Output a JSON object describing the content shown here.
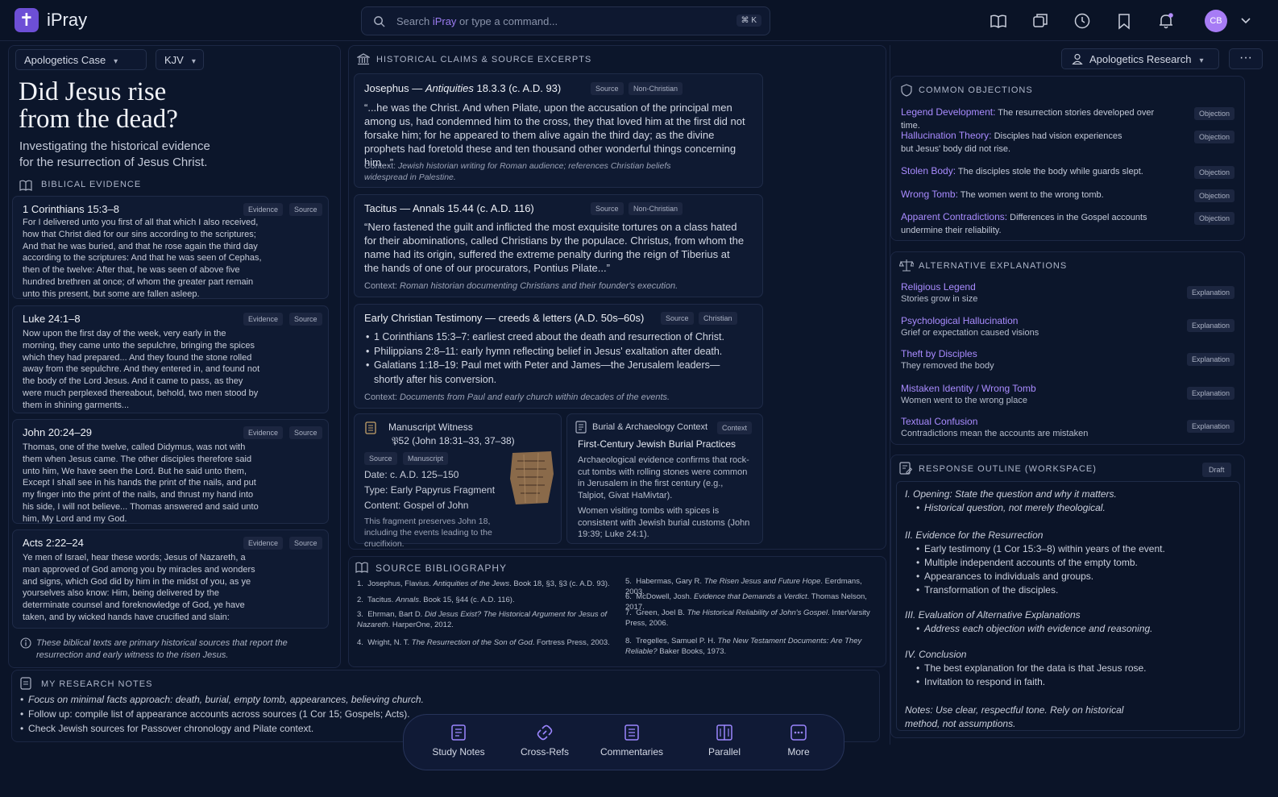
{
  "app": {
    "name": "iPray",
    "logo_glyph": "✝"
  },
  "search": {
    "prefix": "Search ",
    "brand": "iPray",
    "suffix": " or type a command...",
    "shortcut": "⌘ K"
  },
  "topbar": {
    "icons": [
      "book-icon",
      "copy-icon",
      "history-icon",
      "bookmark-icon",
      "bell-icon"
    ],
    "avatar": "CB"
  },
  "left": {
    "case_select": "Apologetics Case",
    "version_select": "KJV",
    "title_line1": "Did Jesus rise",
    "title_line2": "from the dead?",
    "subtitle_line1": "Investigating the historical evidence",
    "subtitle_line2": "for the resurrection of Jesus Christ.",
    "section": "BIBLICAL EVIDENCE",
    "passages": [
      {
        "ref": "1 Corinthians 15:3–8",
        "tag1": "Evidence",
        "tag2": "Source",
        "text": "For I delivered unto you first of all that which I also received, how that Christ died for our sins according to the scriptures; And that he was buried, and that he rose again the third day according to the scriptures: And that he was seen of Cephas, then of the twelve: After that, he was seen of above five hundred brethren at once; of whom the greater part remain unto this present, but some are fallen asleep."
      },
      {
        "ref": "Luke 24:1–8",
        "tag1": "Evidence",
        "tag2": "Source",
        "text": "Now upon the first day of the week, very early in the morning, they came unto the sepulchre, bringing the spices which they had prepared... And they found the stone rolled away from the sepulchre. And they entered in, and found not the body of the Lord Jesus. And it came to pass, as they were much perplexed thereabout, behold, two men stood by them in shining garments..."
      },
      {
        "ref": "John 20:24–29",
        "tag1": "Evidence",
        "tag2": "Source",
        "text": "Thomas, one of the twelve, called Didymus, was not with them when Jesus came. The other disciples therefore said unto him, We have seen the Lord. But he said unto them, Except I shall see in his hands the print of the nails, and put my finger into the print of the nails, and thrust my hand into his side, I will not believe... Thomas answered and said unto him, My Lord and my God."
      },
      {
        "ref": "Acts 2:22–24",
        "tag1": "Evidence",
        "tag2": "Source",
        "text": "Ye men of Israel, hear these words; Jesus of Nazareth, a man approved of God among you by miracles and wonders and signs, which God did by him in the midst of you, as ye yourselves also know: Him, being delivered by the determinate counsel and foreknowledge of God, ye have taken, and by wicked hands have crucified and slain:"
      }
    ],
    "footnote": "These biblical texts are primary historical sources that report the resurrection and early witness to the risen Jesus."
  },
  "notes": {
    "title": "MY RESEARCH NOTES",
    "items": [
      "Focus on minimal facts approach: death, burial, empty tomb, appearances, believing church.",
      "Follow up: compile list of appearance accounts across sources (1 Cor 15; Gospels; Acts).",
      "Check Jewish sources for Passover chronology and Pilate context."
    ]
  },
  "middle": {
    "section": "HISTORICAL CLAIMS & SOURCE EXCERPTS",
    "josephus": {
      "author": "Josephus — ",
      "work": "Antiquities",
      "ref": " 18.3.3 (c. A.D. 93)",
      "tag1": "Source",
      "tag2": "Non-Christian",
      "quote": "“...he was the Christ. And when Pilate, upon the accusation of the principal men among us, had condemned him to the cross, they that loved him at the first did not forsake him; for he appeared to them alive again the third day; as the divine prophets had foretold these and ten thousand other wonderful things concerning him...”",
      "ctx_label": "Context: ",
      "ctx": "Jewish historian writing for Roman audience; references Christian beliefs widespread in Palestine."
    },
    "tacitus": {
      "title": "Tacitus — Annals 15.44 (c. A.D. 116)",
      "tag1": "Source",
      "tag2": "Non-Christian",
      "quote": "“Nero fastened the guilt and inflicted the most exquisite tortures on a class hated for their abominations, called Christians by the populace. Christus, from whom the name had its origin, suffered the extreme penalty during the reign of Tiberius at the hands of one of our procurators, Pontius Pilate...”",
      "ctx_label": "Context: ",
      "ctx": "Roman historian documenting Christians and their founder's execution."
    },
    "early": {
      "title": "Early Christian Testimony — creeds & letters (A.D. 50s–60s)",
      "tag1": "Source",
      "tag2": "Christian",
      "items": [
        "1 Corinthians 15:3–7: earliest creed about the death and resurrection of Christ.",
        "Philippians 2:8–11: early hymn reflecting belief in Jesus' exaltation after death.",
        "Galatians 1:18–19: Paul met with Peter and James—the Jerusalem leaders—shortly after his conversion."
      ],
      "ctx_label": "Context: ",
      "ctx": "Documents from Paul and early church within decades of the events."
    },
    "manuscript": {
      "title": "Manuscript Witness",
      "subtitle": "𝔓52 (John 18:31–33, 37–38)",
      "tag1": "Source",
      "tag2": "Manuscript",
      "date_label": "Date: ",
      "date": "c. A.D. 125–150",
      "type_label": "Type: ",
      "type": "Early Papyrus Fragment",
      "content_label": "Content: ",
      "content": "Gospel of John",
      "desc": "This fragment preserves John 18, including the events leading to the crucifixion."
    },
    "burial": {
      "header": "Burial & Archaeology Context",
      "tag": "Context",
      "title": "First-Century Jewish Burial Practices",
      "p1": "Archaeological evidence confirms that rock-cut tombs with rolling stones were common in Jerusalem in the first century (e.g., Talpiot, Givat HaMivtar).",
      "p2": "Women visiting tombs with spices is consistent with Jewish burial customs (John 19:39; Luke 24:1)."
    },
    "bibliography": {
      "title": "SOURCE BIBLIOGRAPHY",
      "left": [
        {
          "n": "1.",
          "a": "Josephus, Flavius. ",
          "t": "Antiquities of the Jews",
          "r": ". Book 18, §3, §3 (c. A.D. 93)."
        },
        {
          "n": "2.",
          "a": "Tacitus. ",
          "t": "Annals",
          "r": ". Book 15, §44 (c. A.D. 116)."
        },
        {
          "n": "3.",
          "a": "Ehrman, Bart D. ",
          "t": "Did Jesus Exist? The Historical Argument for Jesus of Nazareth",
          "r": ". HarperOne, 2012."
        },
        {
          "n": "4.",
          "a": "Wright, N. T. ",
          "t": "The Resurrection of the Son of God",
          "r": ". Fortress Press, 2003."
        }
      ],
      "right": [
        {
          "n": "5.",
          "a": "Habermas, Gary R. ",
          "t": "The Risen Jesus and Future Hope",
          "r": ". Eerdmans, 2003."
        },
        {
          "n": "6.",
          "a": "McDowell, Josh. ",
          "t": "Evidence that Demands a Verdict",
          "r": ". Thomas Nelson, 2017."
        },
        {
          "n": "7.",
          "a": "Green, Joel B. ",
          "t": "The Historical Reliability of John's Gospel",
          "r": ". InterVarsity Press, 2006."
        },
        {
          "n": "8.",
          "a": "Tregelles, Samuel P. H. ",
          "t": "The New Testament Documents: Are They Reliable?",
          "r": " Baker Books, 1973."
        }
      ]
    }
  },
  "right": {
    "mode_select": "Apologetics Research",
    "more": "···",
    "objections": {
      "title": "COMMON OBJECTIONS",
      "items": [
        {
          "name": "Legend Development:",
          "desc": " The resurrection stories developed over time.",
          "tag": "Objection"
        },
        {
          "name": "Hallucination Theory:",
          "desc": " Disciples had vision experiences but Jesus' body did not rise.",
          "tag": "Objection"
        },
        {
          "name": "Stolen Body:",
          "desc": " The disciples stole the body while guards slept.",
          "tag": "Objection"
        },
        {
          "name": "Wrong Tomb:",
          "desc": " The women went to the wrong tomb.",
          "tag": "Objection"
        },
        {
          "name": "Apparent Contradictions:",
          "desc": " Differences in the Gospel accounts undermine their reliability.",
          "tag": "Objection"
        }
      ]
    },
    "alternatives": {
      "title": "ALTERNATIVE EXPLANATIONS",
      "items": [
        {
          "name": "Religious Legend",
          "desc": "Stories grow in size",
          "tag": "Explanation"
        },
        {
          "name": "Psychological Hallucination",
          "desc": "Grief or expectation caused visions",
          "tag": "Explanation"
        },
        {
          "name": "Theft by Disciples",
          "desc": "They removed the body",
          "tag": "Explanation"
        },
        {
          "name": "Mistaken Identity / Wrong Tomb",
          "desc": "Women went to the wrong place",
          "tag": "Explanation"
        },
        {
          "name": "Textual Confusion",
          "desc": "Contradictions mean the accounts are mistaken",
          "tag": "Explanation"
        }
      ]
    },
    "outline": {
      "title": "RESPONSE OUTLINE (WORKSPACE)",
      "tag": "Draft",
      "sections": [
        {
          "h": "I.  Opening: State the question and why it matters.",
          "items": [
            "Historical question, not merely theological."
          ]
        },
        {
          "h": "II. Evidence for the Resurrection",
          "items": [
            "Early testimony (1 Cor 15:3–8) within years of the event.",
            "Multiple independent accounts of the empty tomb.",
            "Appearances to individuals and groups.",
            "Transformation of the disciples."
          ]
        },
        {
          "h": "III. Evaluation of Alternative Explanations",
          "items": [
            "Address each objection with evidence and reasoning."
          ]
        },
        {
          "h": "IV. Conclusion",
          "items": [
            "The best explanation for the data is that Jesus rose.",
            "Invitation to respond in faith."
          ]
        }
      ],
      "notes": "Notes: Use clear, respectful tone. Rely on historical method, not assumptions."
    }
  },
  "dock": [
    {
      "label": "Study Notes",
      "icon": "study-notes-icon"
    },
    {
      "label": "Cross-Refs",
      "icon": "link-icon"
    },
    {
      "label": "Commentaries",
      "icon": "commentary-icon"
    },
    {
      "label": "Parallel",
      "icon": "parallel-icon"
    },
    {
      "label": "More",
      "icon": "more-icon"
    }
  ],
  "colors": {
    "background": "#0b1428",
    "accent": "#a98bff",
    "logo": "#6d4fd6",
    "avatar": "#a77cf5"
  }
}
